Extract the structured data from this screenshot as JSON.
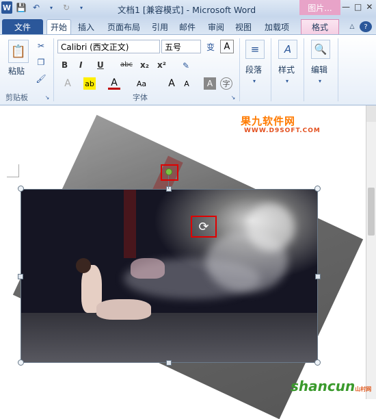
{
  "app": {
    "window_title": "文档1 [兼容模式] - Microsoft Word",
    "context_tab_group": "图片...",
    "logo": "W"
  },
  "tabs": [
    "文件",
    "开始",
    "插入",
    "页面布局",
    "引用",
    "邮件",
    "审阅",
    "视图",
    "加载项",
    "格式"
  ],
  "ribbon": {
    "clipboard": {
      "paste_label": "粘贴",
      "group_label": "剪贴板"
    },
    "font": {
      "font_name": "Calibri (西文正文)",
      "font_size": "五号",
      "group_label": "字体",
      "bold": "B",
      "italic": "I",
      "underline": "U",
      "strikethrough": "abc",
      "subscript": "x₂",
      "superscript": "x²"
    },
    "paragraph_label": "段落",
    "styles_label": "样式",
    "editing_label": "编辑"
  },
  "watermarks": {
    "top": "果九软件网",
    "top_url": "WWW.D9SOFT.COM",
    "bottom": "shancun",
    "bottom_small": "山村网"
  },
  "colors": {
    "accent": "#2b579a",
    "context_tab": "#e8a3c8",
    "highlight_box": "#e00000",
    "rotate_handle": "#7cc242"
  }
}
